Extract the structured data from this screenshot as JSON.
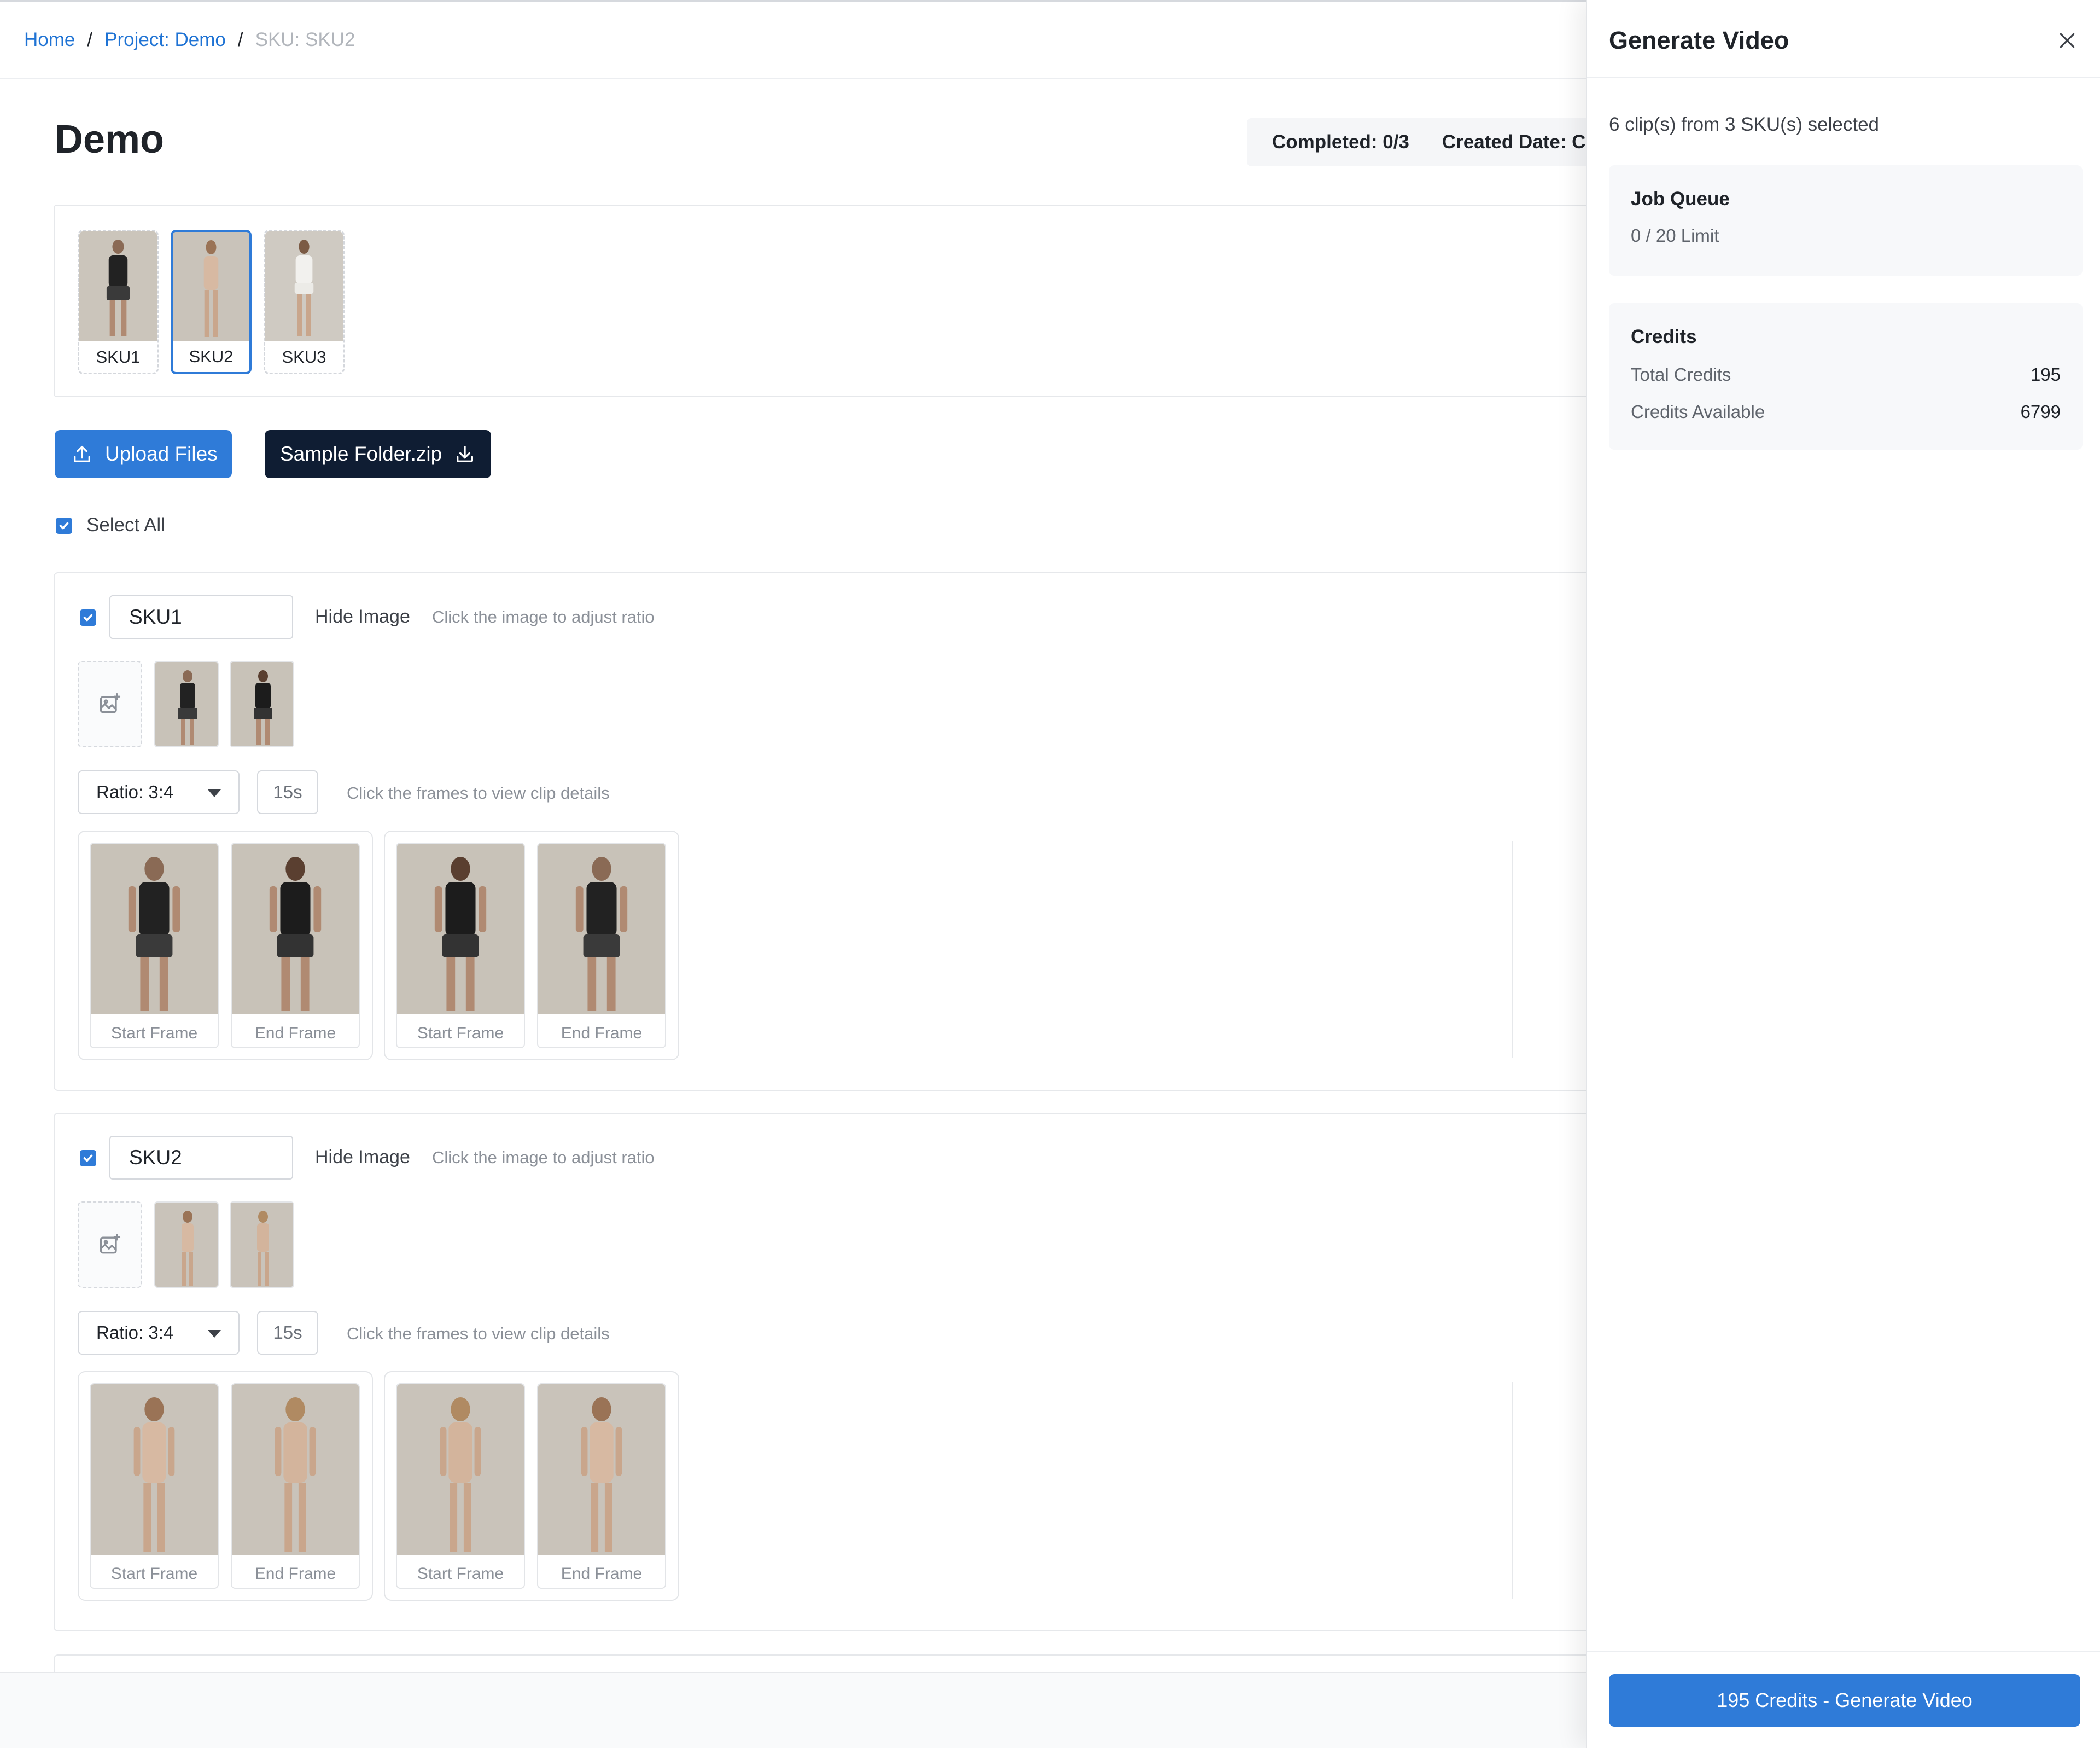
{
  "breadcrumb": {
    "home": "Home",
    "separator": "/",
    "project": "Project: Demo",
    "current": "SKU: SKU2"
  },
  "page": {
    "title": "Demo",
    "completed": "Completed: 0/3",
    "created_date": "Created Date: C"
  },
  "sku_strip": [
    {
      "label": "SKU1",
      "selected": false
    },
    {
      "label": "SKU2",
      "selected": true
    },
    {
      "label": "SKU3",
      "selected": false
    }
  ],
  "actions": {
    "upload": "Upload Files",
    "sample": "Sample Folder.zip"
  },
  "select_all": {
    "label": "Select All",
    "checked": true
  },
  "sku_cards": [
    {
      "name": "SKU1",
      "checked": true,
      "hide_image": "Hide Image",
      "ratio_hint": "Click the image to adjust ratio",
      "ratio": "Ratio: 3:4",
      "duration": "15s",
      "frames_hint": "Click the frames to view clip details",
      "clips": [
        {
          "start": "Start Frame",
          "end": "End Frame"
        },
        {
          "start": "Start Frame",
          "end": "End Frame"
        }
      ]
    },
    {
      "name": "SKU2",
      "checked": true,
      "hide_image": "Hide Image",
      "ratio_hint": "Click the image to adjust ratio",
      "ratio": "Ratio: 3:4",
      "duration": "15s",
      "frames_hint": "Click the frames to view clip details",
      "clips": [
        {
          "start": "Start Frame",
          "end": "End Frame"
        },
        {
          "start": "Start Frame",
          "end": "End Frame"
        }
      ]
    }
  ],
  "drawer": {
    "title": "Generate Video",
    "selection": "6 clip(s) from 3 SKU(s) selected",
    "job_queue": {
      "title": "Job Queue",
      "value": "0 / 20 Limit"
    },
    "credits": {
      "title": "Credits",
      "total_label": "Total Credits",
      "total_value": "195",
      "available_label": "Credits Available",
      "available_value": "6799"
    },
    "generate_button": "195 Credits - Generate Video"
  },
  "colors": {
    "accent": "#2f7bd8",
    "dark_button": "#0f1d33",
    "link": "#1f73d4"
  },
  "icons": [
    "upload-icon",
    "download-icon",
    "add-image-icon",
    "close-icon",
    "check-icon",
    "chevron-down-icon"
  ]
}
